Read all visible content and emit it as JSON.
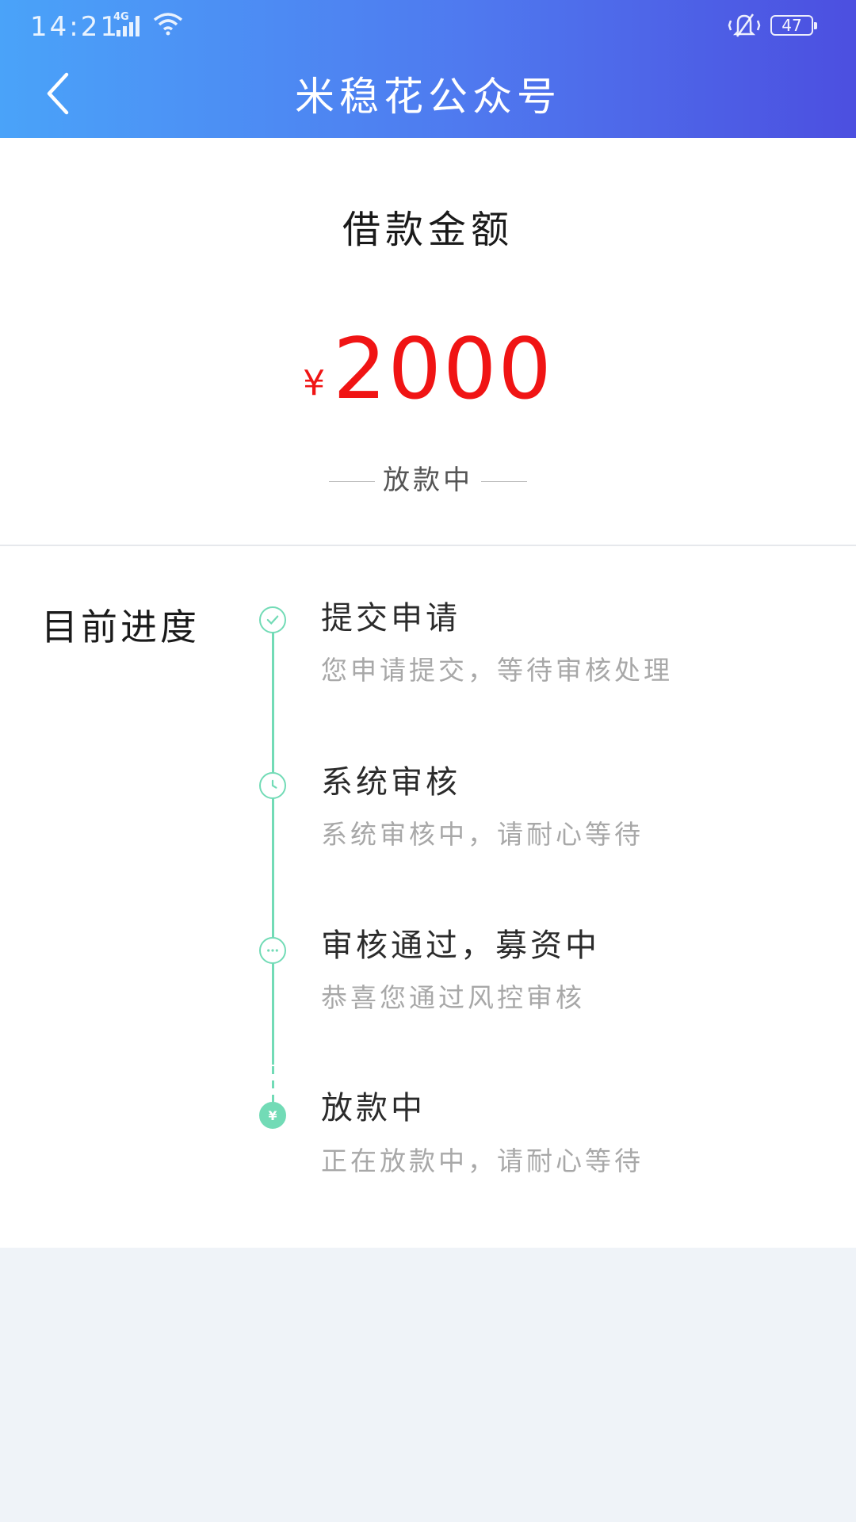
{
  "status_bar": {
    "time": "14:21",
    "network": "4G",
    "battery": "47"
  },
  "header": {
    "title": "米稳花公众号",
    "back_icon": "chevron-left-icon"
  },
  "loan": {
    "title": "借款金额",
    "currency": "¥",
    "amount": "2000",
    "status": "放款中",
    "accent_color": "#f01414"
  },
  "progress": {
    "label": "目前进度",
    "line_color": "#72dbb6",
    "steps": [
      {
        "name": "提交申请",
        "desc": "您申请提交，等待审核处理",
        "icon": "check-icon"
      },
      {
        "name": "系统审核",
        "desc": "系统审核中，请耐心等待",
        "icon": "clock-icon"
      },
      {
        "name": "审核通过，募资中",
        "desc": "恭喜您通过风控审核",
        "icon": "ellipsis-icon"
      },
      {
        "name": "放款中",
        "desc": "正在放款中，请耐心等待",
        "icon": "yen-icon"
      }
    ]
  }
}
